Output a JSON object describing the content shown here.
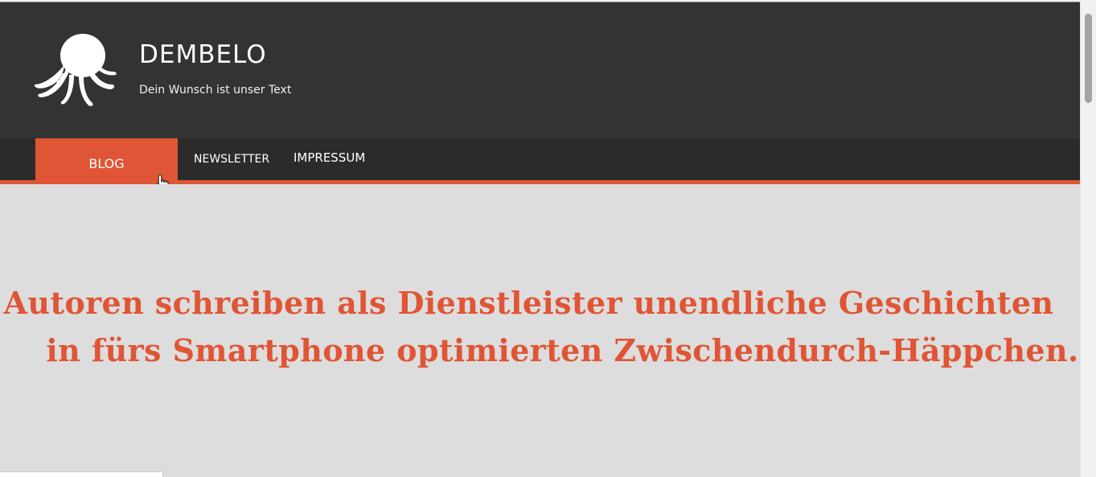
{
  "site": {
    "title": "DEMBELO",
    "tagline": "Dein Wunsch ist unser Text",
    "logo_icon": "octopus-icon"
  },
  "nav": {
    "items": [
      {
        "label": "BLOG",
        "active": true
      },
      {
        "label": "NEWSLETTER",
        "active": false
      },
      {
        "label": "IMPRESSUM",
        "active": false
      }
    ]
  },
  "hero": {
    "line1": "Autoren schreiben als Dienstleister unendliche Geschichten",
    "line2": "in fürs Smartphone optimierten Zwischendurch-Häppchen."
  },
  "colors": {
    "header_bg": "#333333",
    "nav_bg": "#2b2b2b",
    "accent": "#e05535",
    "hero_bg": "#dddddd"
  }
}
